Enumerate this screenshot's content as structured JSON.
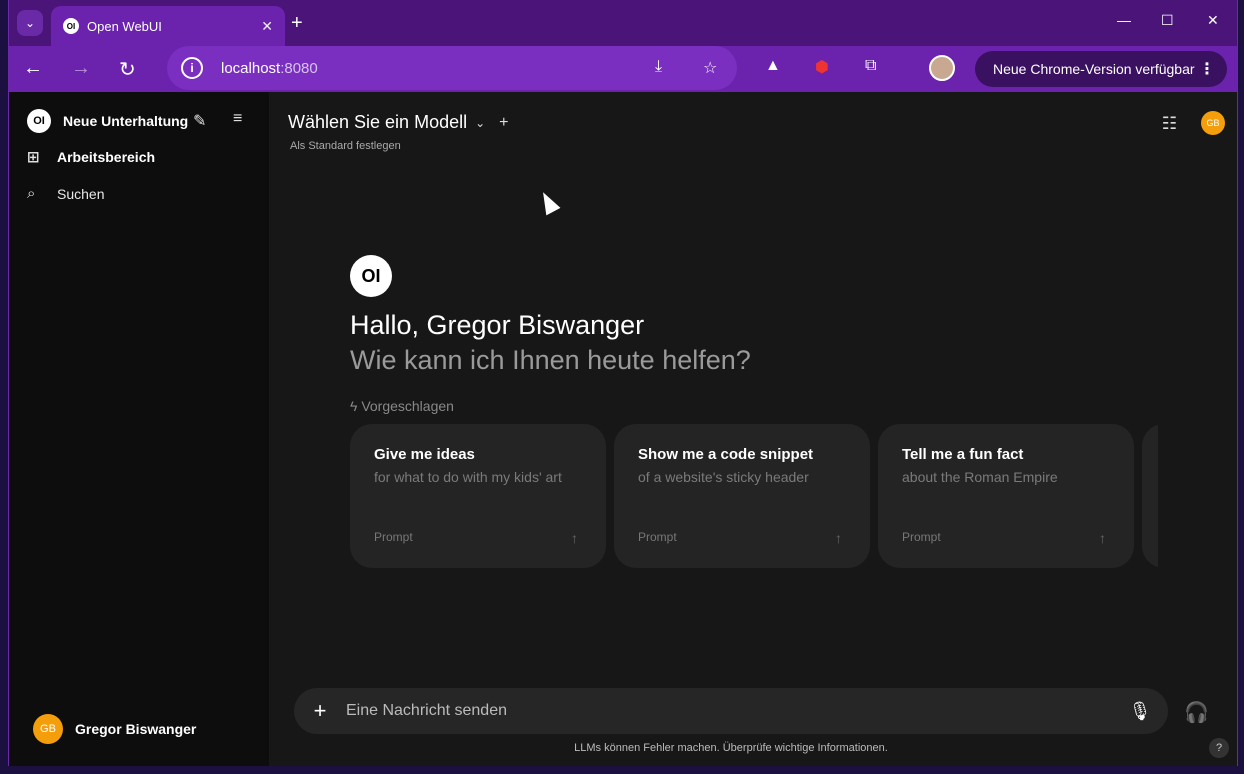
{
  "browser": {
    "tab_title": "Open WebUI",
    "favicon_text": "OI",
    "url_host": "localhost",
    "url_port": ":8080",
    "update_label": "Neue Chrome-Version verfügbar"
  },
  "sidebar": {
    "logo_text": "OI",
    "new_chat": "Neue Unterhaltung",
    "workspace": "Arbeitsbereich",
    "search": "Suchen",
    "user_initials": "GB",
    "user_name": "Gregor Biswanger"
  },
  "header": {
    "model_select": "Wählen Sie ein Modell",
    "set_default": "Als Standard festlegen",
    "avatar_initials": "GB"
  },
  "hero": {
    "logo_text": "OI",
    "greeting": "Hallo, Gregor Biswanger",
    "subtitle": "Wie kann ich Ihnen heute helfen?",
    "suggested_label": "Vorgeschlagen"
  },
  "suggestions": [
    {
      "title": "Give me ideas",
      "subtitle": "for what to do with my kids' art",
      "tag": "Prompt"
    },
    {
      "title": "Show me a code snippet",
      "subtitle": "of a website's sticky header",
      "tag": "Prompt"
    },
    {
      "title": "Tell me a fun fact",
      "subtitle": "about the Roman Empire",
      "tag": "Prompt"
    }
  ],
  "composer": {
    "placeholder": "Eine Nachricht senden",
    "disclaimer": "LLMs können Fehler machen. Überprüfe wichtige Informationen."
  },
  "help_label": "?",
  "colors": {
    "accent_orange": "#f59e0b",
    "chrome_purple": "#6b22ad",
    "background": "#171717"
  }
}
